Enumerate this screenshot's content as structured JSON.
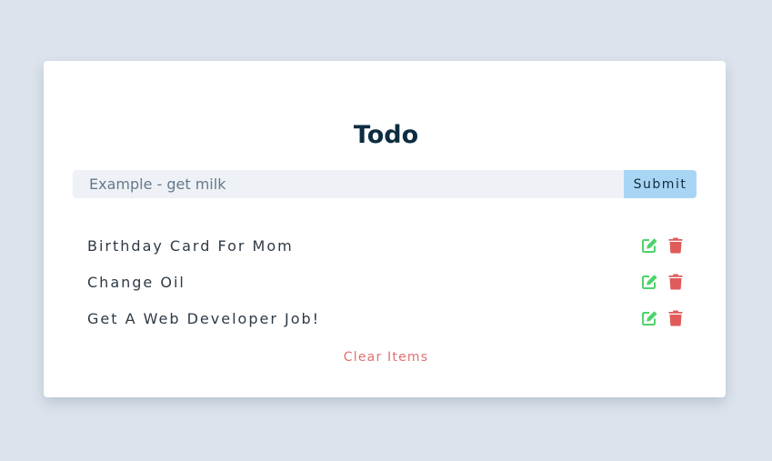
{
  "app": {
    "title": "Todo"
  },
  "form": {
    "placeholder": "Example - get milk",
    "value": "",
    "submit_label": "Submit"
  },
  "items": [
    {
      "text": "Birthday Card For Mom"
    },
    {
      "text": "Change Oil"
    },
    {
      "text": "Get A Web Developer Job!"
    }
  ],
  "clear_label": "Clear Items",
  "colors": {
    "background": "#dce3ec",
    "edit_icon": "#4fd36b",
    "delete_icon": "#e05a5a",
    "submit_bg": "#a9d5f5",
    "clear_text": "#e07070"
  },
  "icons": {
    "edit": "edit-icon",
    "delete": "trash-icon"
  }
}
